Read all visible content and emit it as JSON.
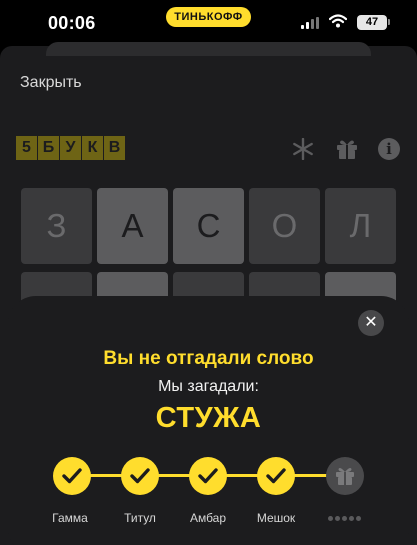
{
  "status_bar": {
    "time": "00:06",
    "brand": "ТИНЬКОФФ",
    "battery": "47",
    "icons": [
      "signal-icon",
      "wifi-icon",
      "battery-icon"
    ]
  },
  "game": {
    "close_label": "Закрыть",
    "logo_letters": [
      "5",
      "Б",
      "У",
      "К",
      "В"
    ],
    "toolbar_icons": [
      "snowflake-icon",
      "gift-icon",
      "info-icon"
    ],
    "info_glyph": "i",
    "row1": [
      "З",
      "А",
      "С",
      "О",
      "Л"
    ],
    "row2": [
      "",
      "",
      "",
      "",
      ""
    ]
  },
  "modal": {
    "close_glyph": "✕",
    "title": "Вы не отгадали слово",
    "subtitle": "Мы загадали:",
    "answer": "СТУЖА",
    "steps": [
      {
        "label": "Гамма",
        "state": "done"
      },
      {
        "label": "Титул",
        "state": "done"
      },
      {
        "label": "Амбар",
        "state": "done"
      },
      {
        "label": "Мешок",
        "state": "done"
      },
      {
        "label": "",
        "state": "locked",
        "icon": "gift-icon"
      }
    ]
  },
  "colors": {
    "accent": "#ffdd2d",
    "background": "#000000",
    "sheet": "#1c1c1e",
    "tile": "#3a3a3c"
  }
}
